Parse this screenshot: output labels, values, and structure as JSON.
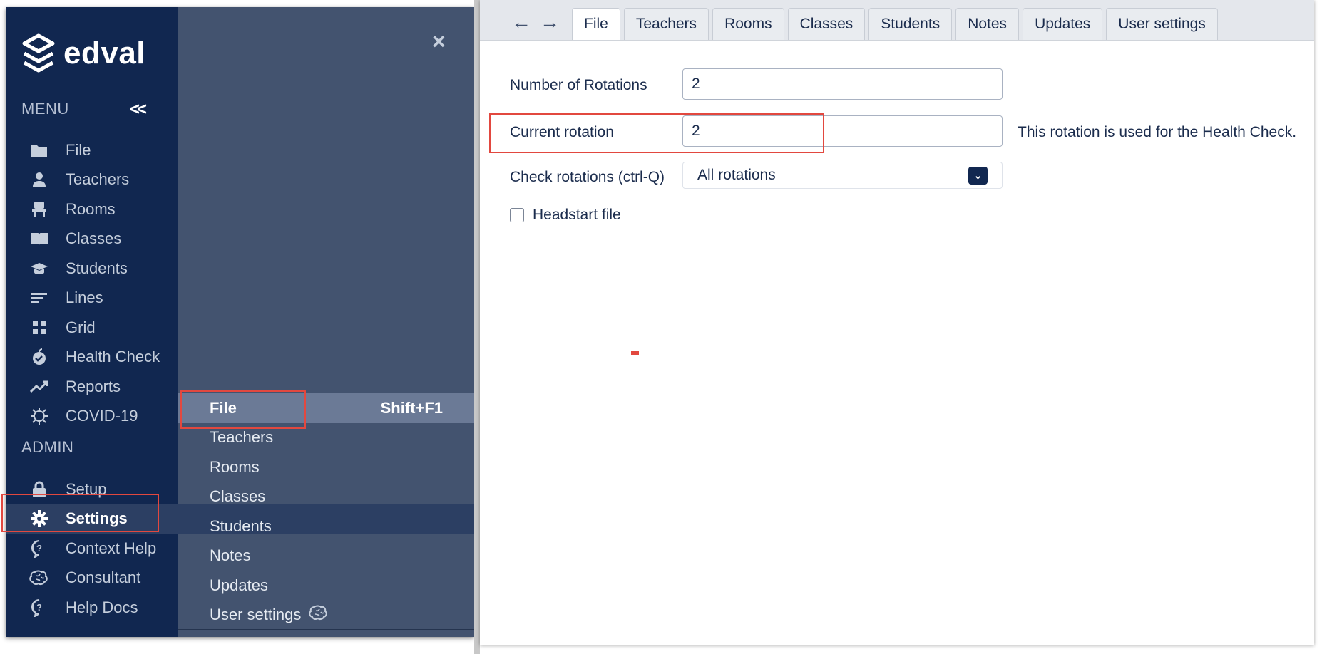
{
  "brand": {
    "name": "edval"
  },
  "sidebar": {
    "menu_label": "MENU",
    "collapse": "<<",
    "menu_items": [
      {
        "label": "File",
        "icon": "folder-icon"
      },
      {
        "label": "Teachers",
        "icon": "person-icon"
      },
      {
        "label": "Rooms",
        "icon": "chair-icon"
      },
      {
        "label": "Classes",
        "icon": "book-icon"
      },
      {
        "label": "Students",
        "icon": "graduation-cap-icon"
      },
      {
        "label": "Lines",
        "icon": "lines-icon"
      },
      {
        "label": "Grid",
        "icon": "grid-icon"
      },
      {
        "label": "Health Check",
        "icon": "apple-check-icon"
      },
      {
        "label": "Reports",
        "icon": "trend-icon"
      },
      {
        "label": "COVID-19",
        "icon": "virus-icon"
      }
    ],
    "admin_label": "ADMIN",
    "admin_items": [
      {
        "label": "Setup",
        "icon": "lock-icon"
      },
      {
        "label": "Settings",
        "icon": "gear-icon"
      },
      {
        "label": "Context Help",
        "icon": "help-bubble-icon"
      },
      {
        "label": "Consultant",
        "icon": "brain-icon"
      },
      {
        "label": "Help Docs",
        "icon": "help-bubble-icon"
      }
    ]
  },
  "submenu": {
    "close": "×",
    "items": [
      {
        "label": "File",
        "shortcut": "Shift+F1"
      },
      {
        "label": "Teachers"
      },
      {
        "label": "Rooms"
      },
      {
        "label": "Classes"
      },
      {
        "label": "Students"
      },
      {
        "label": "Notes"
      },
      {
        "label": "Updates"
      },
      {
        "label": "User settings",
        "icon": "brain-icon"
      }
    ]
  },
  "tabs": {
    "back": "←",
    "forward": "→",
    "items": [
      "File",
      "Teachers",
      "Rooms",
      "Classes",
      "Students",
      "Notes",
      "Updates",
      "User settings"
    ],
    "active": "File"
  },
  "form": {
    "rotations_label": "Number of Rotations",
    "rotations_value": "2",
    "current_label": "Current rotation",
    "current_value": "2",
    "current_help": "This rotation is used for the Health Check.",
    "check_label": "Check rotations (ctrl-Q)",
    "check_value": "All rotations",
    "headstart_label": "Headstart file",
    "headstart_checked": false
  },
  "colors": {
    "sidebar_bg": "#112750",
    "flyout_bg": "#43536f",
    "active_bg": "#6b7a96",
    "highlight": "#e2483f"
  }
}
